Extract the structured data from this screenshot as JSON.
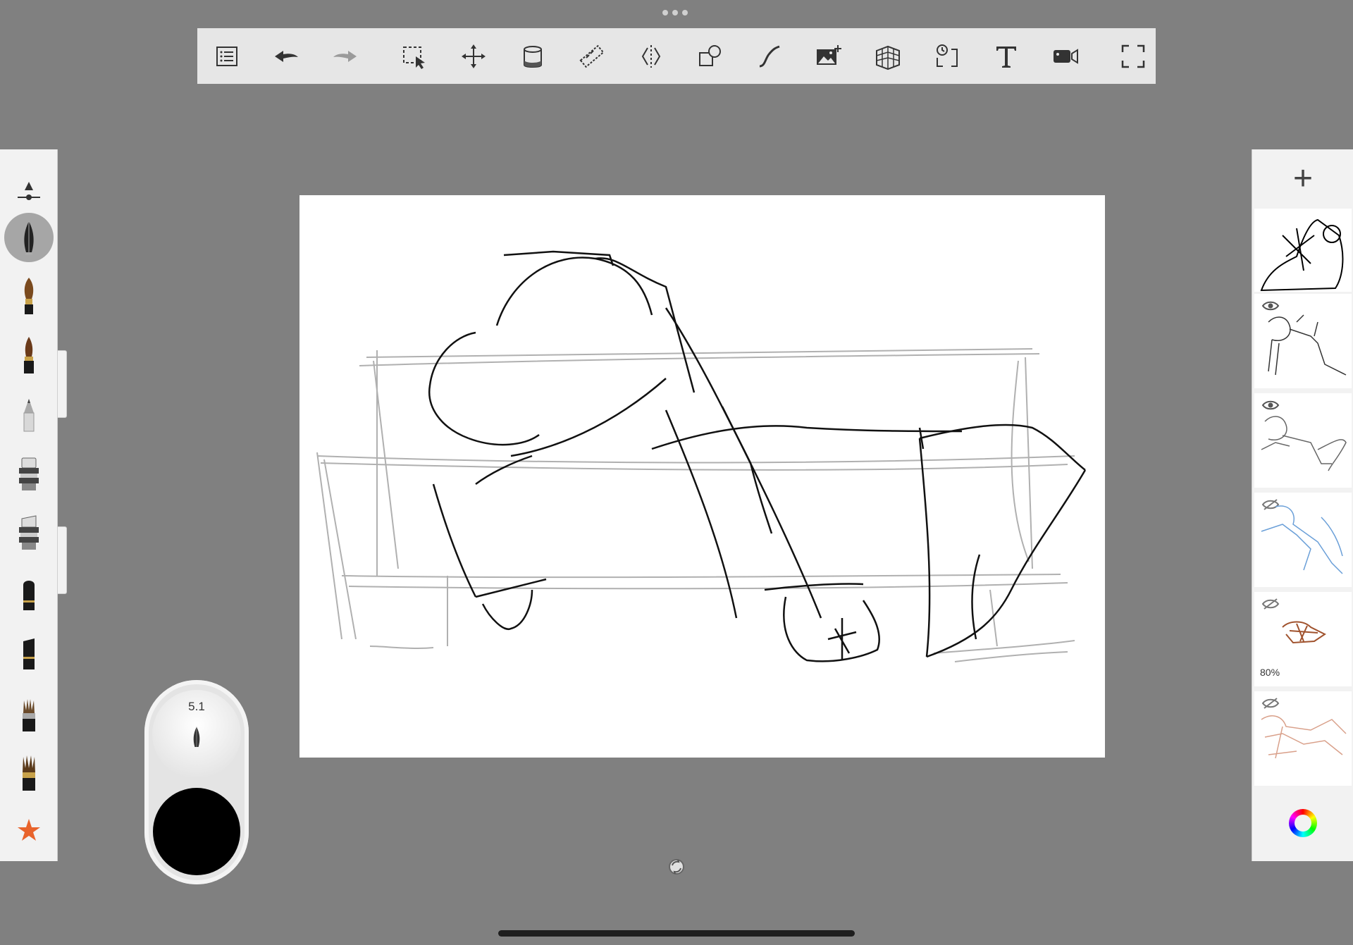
{
  "toolbar": {
    "tools": [
      {
        "name": "layers-list-icon"
      },
      {
        "name": "undo-icon"
      },
      {
        "name": "redo-icon"
      },
      {
        "name": "selection-icon"
      },
      {
        "name": "transform-icon"
      },
      {
        "name": "fill-bucket-icon"
      },
      {
        "name": "ruler-icon"
      },
      {
        "name": "symmetry-icon"
      },
      {
        "name": "shapes-icon"
      },
      {
        "name": "curve-icon"
      },
      {
        "name": "import-image-icon"
      },
      {
        "name": "perspective-grid-icon"
      },
      {
        "name": "time-lapse-icon"
      },
      {
        "name": "text-icon"
      },
      {
        "name": "record-video-icon"
      },
      {
        "name": "fullscreen-icon"
      }
    ]
  },
  "brushes": {
    "items": [
      {
        "name": "brush-size-opacity-control"
      },
      {
        "name": "inking-pen",
        "active": true
      },
      {
        "name": "paint-brush"
      },
      {
        "name": "marker-brush"
      },
      {
        "name": "pencil"
      },
      {
        "name": "airbrush"
      },
      {
        "name": "textured-airbrush"
      },
      {
        "name": "soft-eraser"
      },
      {
        "name": "hard-eraser"
      },
      {
        "name": "bristle-brush"
      },
      {
        "name": "flat-brush"
      },
      {
        "name": "favorites-star"
      }
    ]
  },
  "brush_widget": {
    "size": "5.1",
    "color": "#000000"
  },
  "layers": {
    "add_label": "+",
    "items": [
      {
        "visible": true,
        "thumb_color": "#000000"
      },
      {
        "visible": true,
        "thumb_color": "#000000"
      },
      {
        "visible": true,
        "thumb_color": "#555555"
      },
      {
        "visible": false,
        "thumb_color": "#6a9fd8"
      },
      {
        "visible": false,
        "thumb_color": "#a0522d",
        "opacity": "80%"
      },
      {
        "visible": false,
        "thumb_color": "#d9a08a"
      }
    ]
  }
}
